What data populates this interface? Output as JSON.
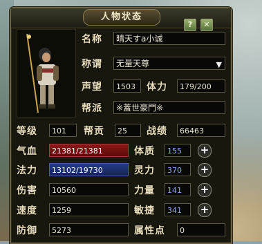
{
  "window": {
    "title": "人物状态",
    "help_label": "?",
    "close_label": "✕"
  },
  "profile": {
    "name_label": "名称",
    "name_value": "晴天すa小诚",
    "title_label": "称谓",
    "title_value": "无量天尊",
    "prestige_label": "声望",
    "prestige_value": "1503",
    "stamina_label": "体力",
    "stamina_value": "179/200",
    "faction_label": "帮派",
    "faction_value": "※蓋世豪門※"
  },
  "stats": {
    "level_label": "等级",
    "level_value": "101",
    "contribution_label": "帮贡",
    "contribution_value": "25",
    "merit_label": "战绩",
    "merit_value": "66463",
    "hp_label": "气血",
    "hp_value": "21381/21381",
    "mp_label": "法力",
    "mp_value": "13102/19730",
    "damage_label": "伤害",
    "damage_value": "10560",
    "speed_label": "速度",
    "speed_value": "1259",
    "defense_label": "防御",
    "defense_value": "5273"
  },
  "attributes": {
    "constitution_label": "体质",
    "constitution_value": "155",
    "spirit_label": "灵力",
    "spirit_value": "370",
    "strength_label": "力量",
    "strength_value": "141",
    "agility_label": "敏捷",
    "agility_value": "341",
    "points_label": "属性点",
    "points_value": "0",
    "plus_label": "+"
  },
  "colors": {
    "hp_bar": "#8c1717",
    "mp_bar": "#243a86",
    "attr_value": "#8ea4ff"
  }
}
